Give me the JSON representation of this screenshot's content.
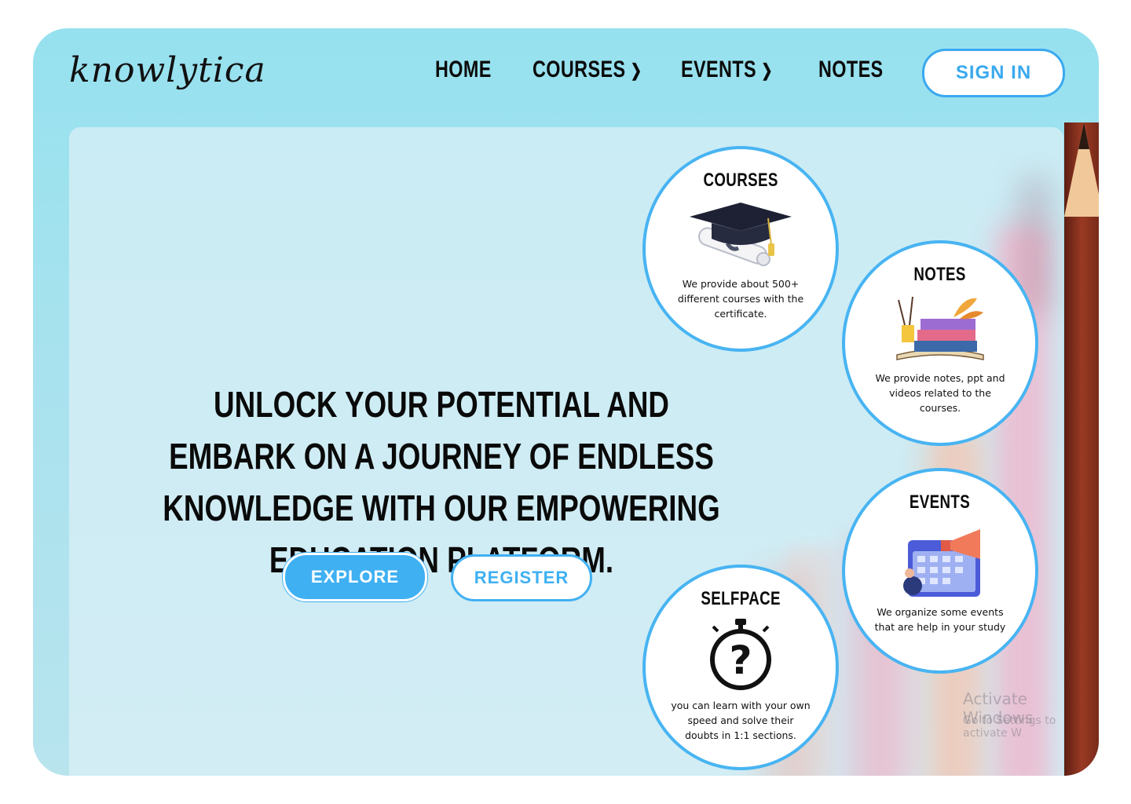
{
  "brand": {
    "logo": "knowlytica"
  },
  "nav": {
    "items": [
      {
        "label": "HOME"
      },
      {
        "label": "COURSES",
        "has_dropdown": true
      },
      {
        "label": "EVENTS",
        "has_dropdown": true
      },
      {
        "label": "NOTES"
      }
    ],
    "signin_label": "SIGN IN"
  },
  "hero": {
    "headline": "UNLOCK YOUR POTENTIAL AND EMBARK ON A JOURNEY OF ENDLESS KNOWLEDGE WITH OUR EMPOWERING EDUCATION PLATFORM.",
    "explore_label": "EXPLORE",
    "register_label": "REGISTER"
  },
  "features": {
    "courses": {
      "title": "COURSES",
      "desc": "We provide about 500+ different courses with the certificate.",
      "icon": "graduation-cap-icon"
    },
    "notes": {
      "title": "NOTES",
      "desc": "We provide notes, ppt and videos related to the courses.",
      "icon": "books-icon"
    },
    "events": {
      "title": "EVENTS",
      "desc": "We organize some events that are help in your study",
      "icon": "calendar-megaphone-icon"
    },
    "selfpace": {
      "title": "SELFPACE",
      "desc": "you can learn with your own speed and solve their doubts in 1:1 sections.",
      "icon": "stopwatch-question-icon"
    }
  },
  "watermark": {
    "line1": "Activate Windows",
    "line2": "Go to Settings to activate W"
  },
  "colors": {
    "accent": "#3fb0f2",
    "background": "#96e1ef",
    "text": "#0b0b0b"
  }
}
